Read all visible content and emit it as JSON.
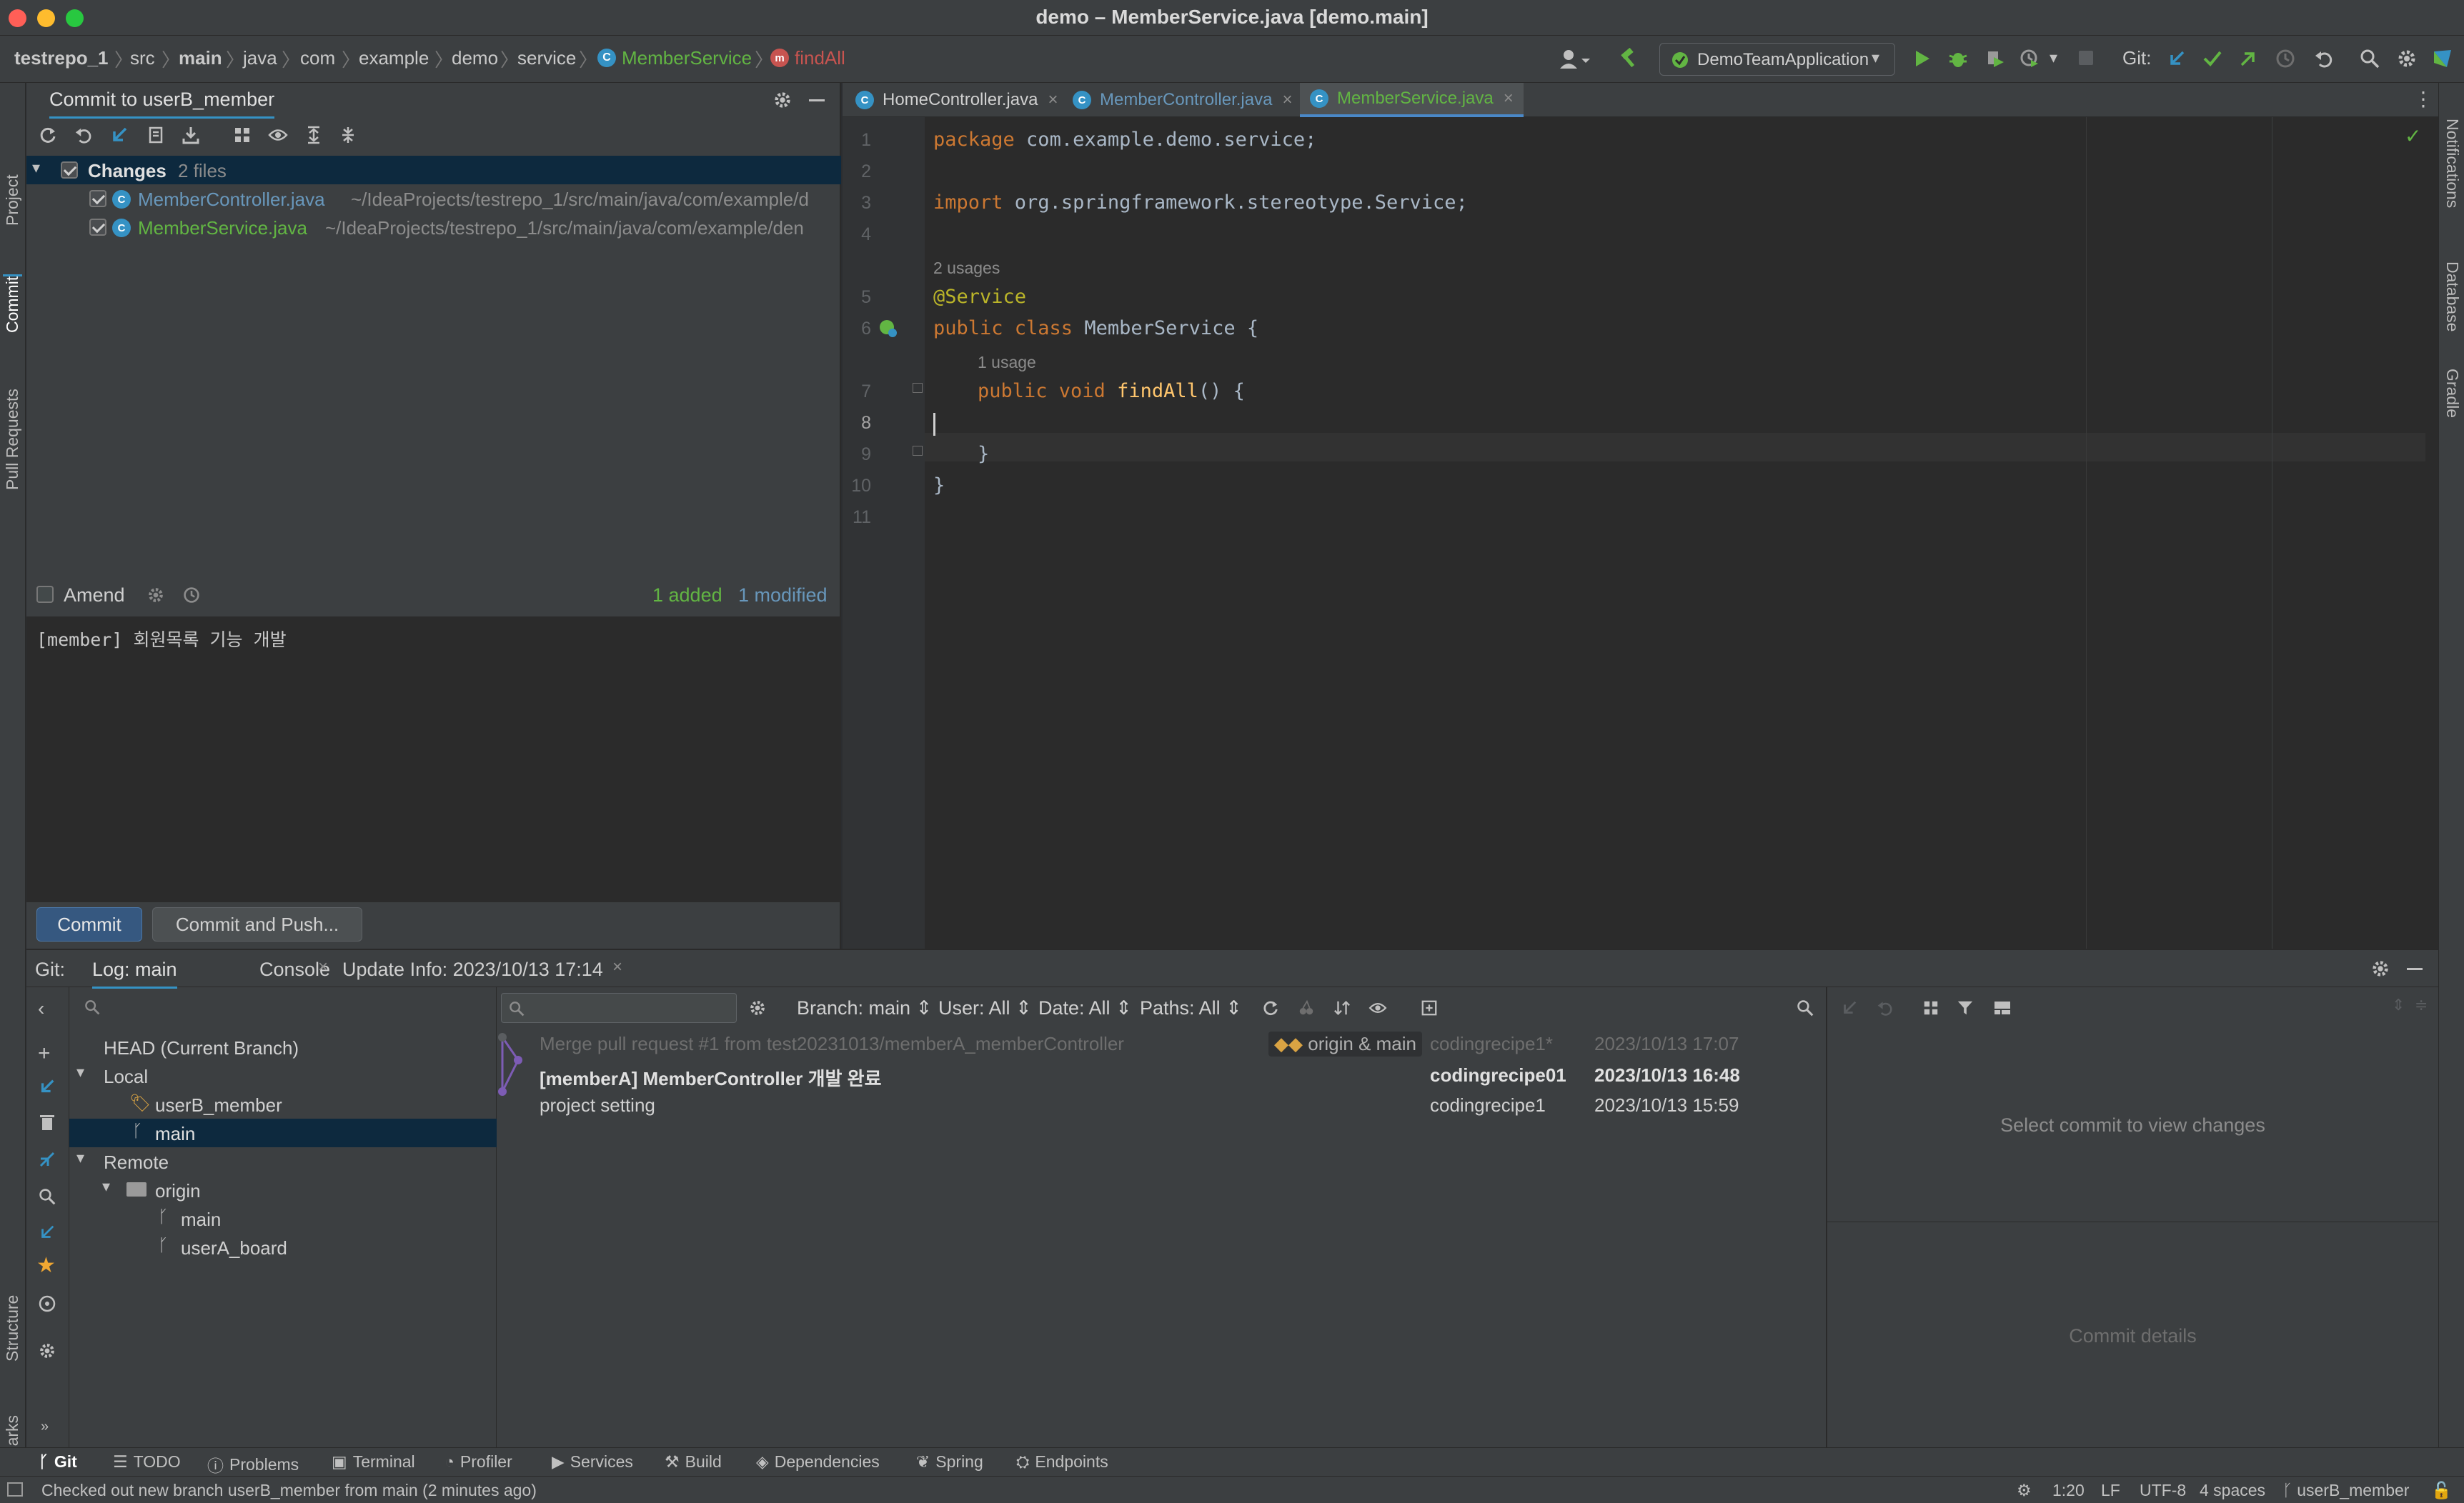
{
  "window": {
    "title": "demo – MemberService.java [demo.main]"
  },
  "breadcrumbs": [
    "testrepo_1",
    "src",
    "main",
    "java",
    "com",
    "example",
    "demo",
    "service",
    "MemberService",
    "findAll"
  ],
  "toolbar": {
    "run_config": "DemoTeamApplication",
    "git_label": "Git:"
  },
  "commit_panel": {
    "title": "Commit to userB_member",
    "changes_label": "Changes",
    "changes_count": "2 files",
    "files": [
      {
        "name": "MemberController.java",
        "path": "~/IdeaProjects/testrepo_1/src/main/java/com/example/d"
      },
      {
        "name": "MemberService.java",
        "path": "~/IdeaProjects/testrepo_1/src/main/java/com/example/den"
      }
    ],
    "amend_label": "Amend",
    "added": "1 added",
    "modified": "1 modified",
    "message": "[member] 회원목록 기능 개발",
    "commit_button": "Commit",
    "commit_push_button": "Commit and Push..."
  },
  "editor": {
    "tabs": [
      {
        "label": "HomeController.java",
        "active": false
      },
      {
        "label": "MemberController.java",
        "active": false
      },
      {
        "label": "MemberService.java",
        "active": true
      }
    ],
    "line_numbers": [
      "1",
      "2",
      "3",
      "4",
      "5",
      "6",
      "7",
      "8",
      "9",
      "10",
      "11"
    ],
    "code": {
      "l1_kw": "package",
      "l1_rest": " com.example.demo.service;",
      "l3_kw": "import",
      "l3_rest": " org.springframework.stereotype.Service;",
      "hint_usages": "2 usages",
      "l5_ann": "@Service",
      "l6_kw": "public class",
      "l6_rest": " MemberService {",
      "hint_usage": "1 usage",
      "l7_kw": "public void",
      "l7_fn": "findAll",
      "l7_rest": "() {",
      "l9": "}",
      "l10": "}"
    }
  },
  "git_panel": {
    "label": "Git:",
    "tabs": [
      "Log: main",
      "Console",
      "Update Info: 2023/10/13 17:14"
    ],
    "filters": {
      "branch": "Branch: main",
      "user": "User: All",
      "date": "Date: All",
      "paths": "Paths: All"
    },
    "branches": {
      "head": "HEAD (Current Branch)",
      "local_label": "Local",
      "local": [
        "userB_member",
        "main"
      ],
      "remote_label": "Remote",
      "origin_label": "origin",
      "remote": [
        "main",
        "userA_board"
      ]
    },
    "commits": [
      {
        "message": "Merge pull request #1 from test20231013/memberA_memberController",
        "tag": "origin & main",
        "author": "codingrecipe1*",
        "date": "2023/10/13 17:07"
      },
      {
        "message": "[memberA] MemberController 개발 완료",
        "author": "codingrecipe01",
        "date": "2023/10/13 16:48"
      },
      {
        "message": "project setting",
        "author": "codingrecipe1",
        "date": "2023/10/13 15:59"
      }
    ],
    "details_placeholder": "Select commit to view changes",
    "commit_details_label": "Commit details"
  },
  "tool_windows": {
    "left": [
      "Project",
      "Commit",
      "Pull Requests",
      "Structure",
      "Bookmarks"
    ],
    "right": [
      "Notifications",
      "Database",
      "Gradle"
    ],
    "bottom": [
      "Git",
      "TODO",
      "Problems",
      "Terminal",
      "Profiler",
      "Services",
      "Build",
      "Dependencies",
      "Spring",
      "Endpoints"
    ]
  },
  "status_bar": {
    "message": "Checked out new branch userB_member from main (2 minutes ago)",
    "position": "1:20",
    "line_sep": "LF",
    "encoding": "UTF-8",
    "indent": "4 spaces",
    "branch": "userB_member"
  },
  "colors": {
    "accent": "#3592c4",
    "added": "#62b543",
    "modified": "#6897bb",
    "selection": "#0d293e"
  }
}
